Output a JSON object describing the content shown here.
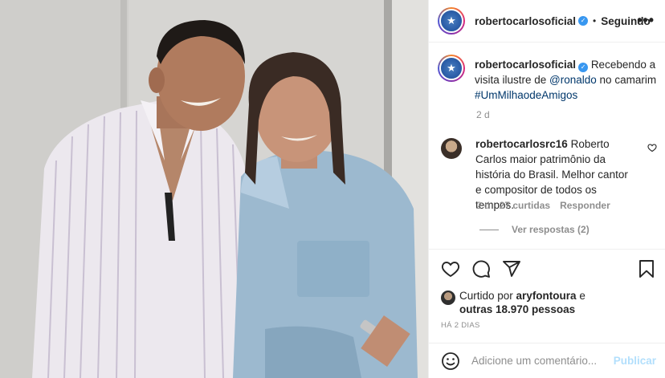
{
  "post": {
    "username": "robertocarlosoficial",
    "separator": "•",
    "follow_label": "Seguindo",
    "more_label": "•••",
    "caption": {
      "text_before": "Recebendo a visita ilustre de ",
      "mention": "@ronaldo",
      "text_after": " no camarim ",
      "hashtag": "#UmMilhaodeAmigos"
    },
    "age": "2 d"
  },
  "comment": {
    "username": "robertocarlosrc16",
    "text": "Roberto Carlos maior patrimônio da história do Brasil. Melhor cantor e compositor de todos os tempos.",
    "age": "2 d",
    "likes": "27 curtidas",
    "reply_label": "Responder",
    "view_replies": "Ver respostas (2)"
  },
  "likes": {
    "prefix": "Curtido por ",
    "user": "aryfontoura",
    "middle": " e",
    "others": "outras 18.970 pessoas"
  },
  "timestamp": "HÁ 2 DIAS",
  "add_comment": {
    "placeholder": "Adicione um comentário...",
    "publish_label": "Publicar"
  },
  "colors": {
    "link": "#00376b",
    "verified": "#3897f0",
    "publish_disabled": "#b2dffc",
    "muted": "#8e8e8e"
  },
  "icons": [
    "verified-badge-icon",
    "more-options-icon",
    "heart-icon",
    "comment-icon",
    "share-icon",
    "save-icon",
    "emoji-icon"
  ]
}
